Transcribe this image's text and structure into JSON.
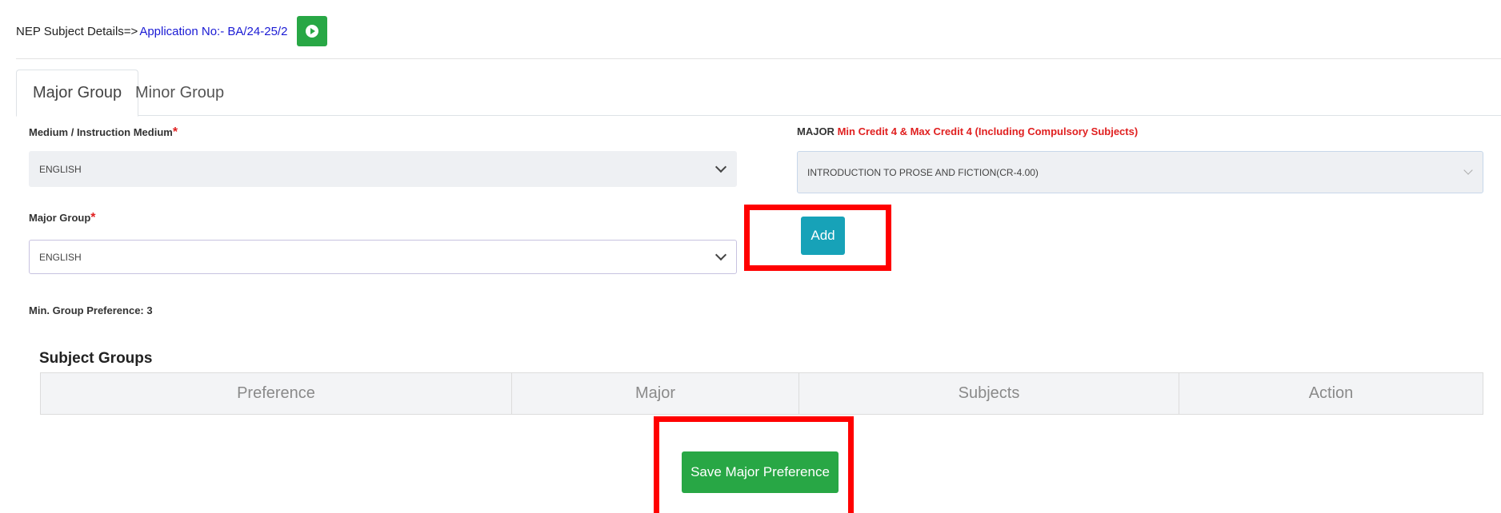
{
  "header": {
    "prefix": "NEP Subject Details=>",
    "application_label": "Application No:- BA/24-25/2"
  },
  "tabs": [
    {
      "label": "Major Group",
      "active": true
    },
    {
      "label": "Minor Group",
      "active": false
    }
  ],
  "form": {
    "medium_label": "Medium / Instruction Medium",
    "medium_value": "ENGLISH",
    "major_group_label": "Major Group",
    "major_group_value": "ENGLISH",
    "major_label_prefix": "MAJOR",
    "major_label_note": "Min Credit 4 & Max Credit 4 (Including Compulsory Subjects)",
    "major_subject_value": "INTRODUCTION TO PROSE AND FICTION(CR-4.00)",
    "required_mark": "*",
    "add_label": "Add",
    "min_group_preference": "Min. Group Preference: 3"
  },
  "subject_groups": {
    "title": "Subject Groups",
    "columns": [
      "Preference",
      "Major",
      "Subjects",
      "Action"
    ],
    "rows": []
  },
  "actions": {
    "save_label": "Save Major Preference"
  },
  "colors": {
    "success": "#28a745",
    "info": "#17a2b8",
    "highlight": "#ff0000",
    "required": "#e02020",
    "link": "#1a1ad4"
  },
  "icons": {
    "go_button": "play-circle-icon",
    "select_arrow": "chevron-down-icon"
  }
}
